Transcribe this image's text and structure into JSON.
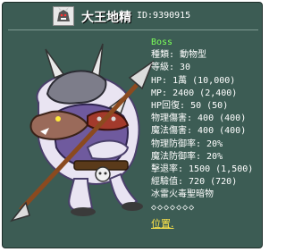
{
  "header": {
    "monster_name": "大王地精",
    "id_text": "ID:9390915"
  },
  "stats": {
    "boss_tag": "Boss",
    "lines": [
      "種類: 動物型",
      "等級: 30",
      "HP: 1萬 (10,000)",
      "MP: 2400 (2,400)",
      "HP回復: 50 (50)",
      "物理傷害: 400 (400)",
      "魔法傷害: 400 (400)",
      "物理防御率: 20%",
      "魔法防御率: 20%",
      "擊退率: 1500 (1,500)",
      "經驗值: 720 (720)",
      "冰雷火毒聖暗物",
      "◇◇◇◇◇◇◇"
    ],
    "location_link": "位置."
  },
  "colors": {
    "panel_bg": "#3c5c54",
    "boss_green": "#7cff5a",
    "link_yellow": "#ffe64a"
  },
  "icons": {
    "avatar": "goblin-king-avatar-icon",
    "monster_art": "goblin-king-sprite"
  }
}
